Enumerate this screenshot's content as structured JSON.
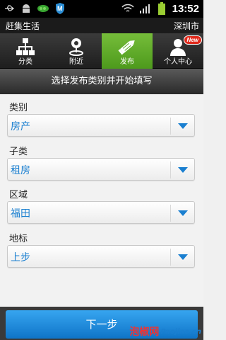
{
  "status_bar": {
    "time": "13:52",
    "icons": [
      "usb-icon",
      "android-icon",
      "peas-icon",
      "shield-m-icon",
      "wifi-icon",
      "signal-icon",
      "battery-icon"
    ]
  },
  "title_bar": {
    "app_title": "赶集生活",
    "city": "深圳市"
  },
  "tabs": [
    {
      "label": "分类",
      "icon": "category-tree-icon",
      "active": false
    },
    {
      "label": "附近",
      "icon": "location-pin-icon",
      "active": false
    },
    {
      "label": "发布",
      "icon": "pencil-icon",
      "active": true
    },
    {
      "label": "个人中心",
      "icon": "person-icon",
      "active": false,
      "badge": "New"
    }
  ],
  "section_header": "选择发布类别并开始填写",
  "form": {
    "fields": [
      {
        "label": "类别",
        "value": "房产"
      },
      {
        "label": "子类",
        "value": "租房"
      },
      {
        "label": "区域",
        "value": "福田"
      },
      {
        "label": "地标",
        "value": "上步"
      }
    ]
  },
  "bottom": {
    "button_label": "下一步"
  },
  "watermark": {
    "cn": "泡椒网",
    "en": "Paojiao.cn"
  },
  "colors": {
    "accent_green": "#5fad2a",
    "link_blue": "#1a7fd0",
    "button_blue": "#1f8ce0"
  }
}
